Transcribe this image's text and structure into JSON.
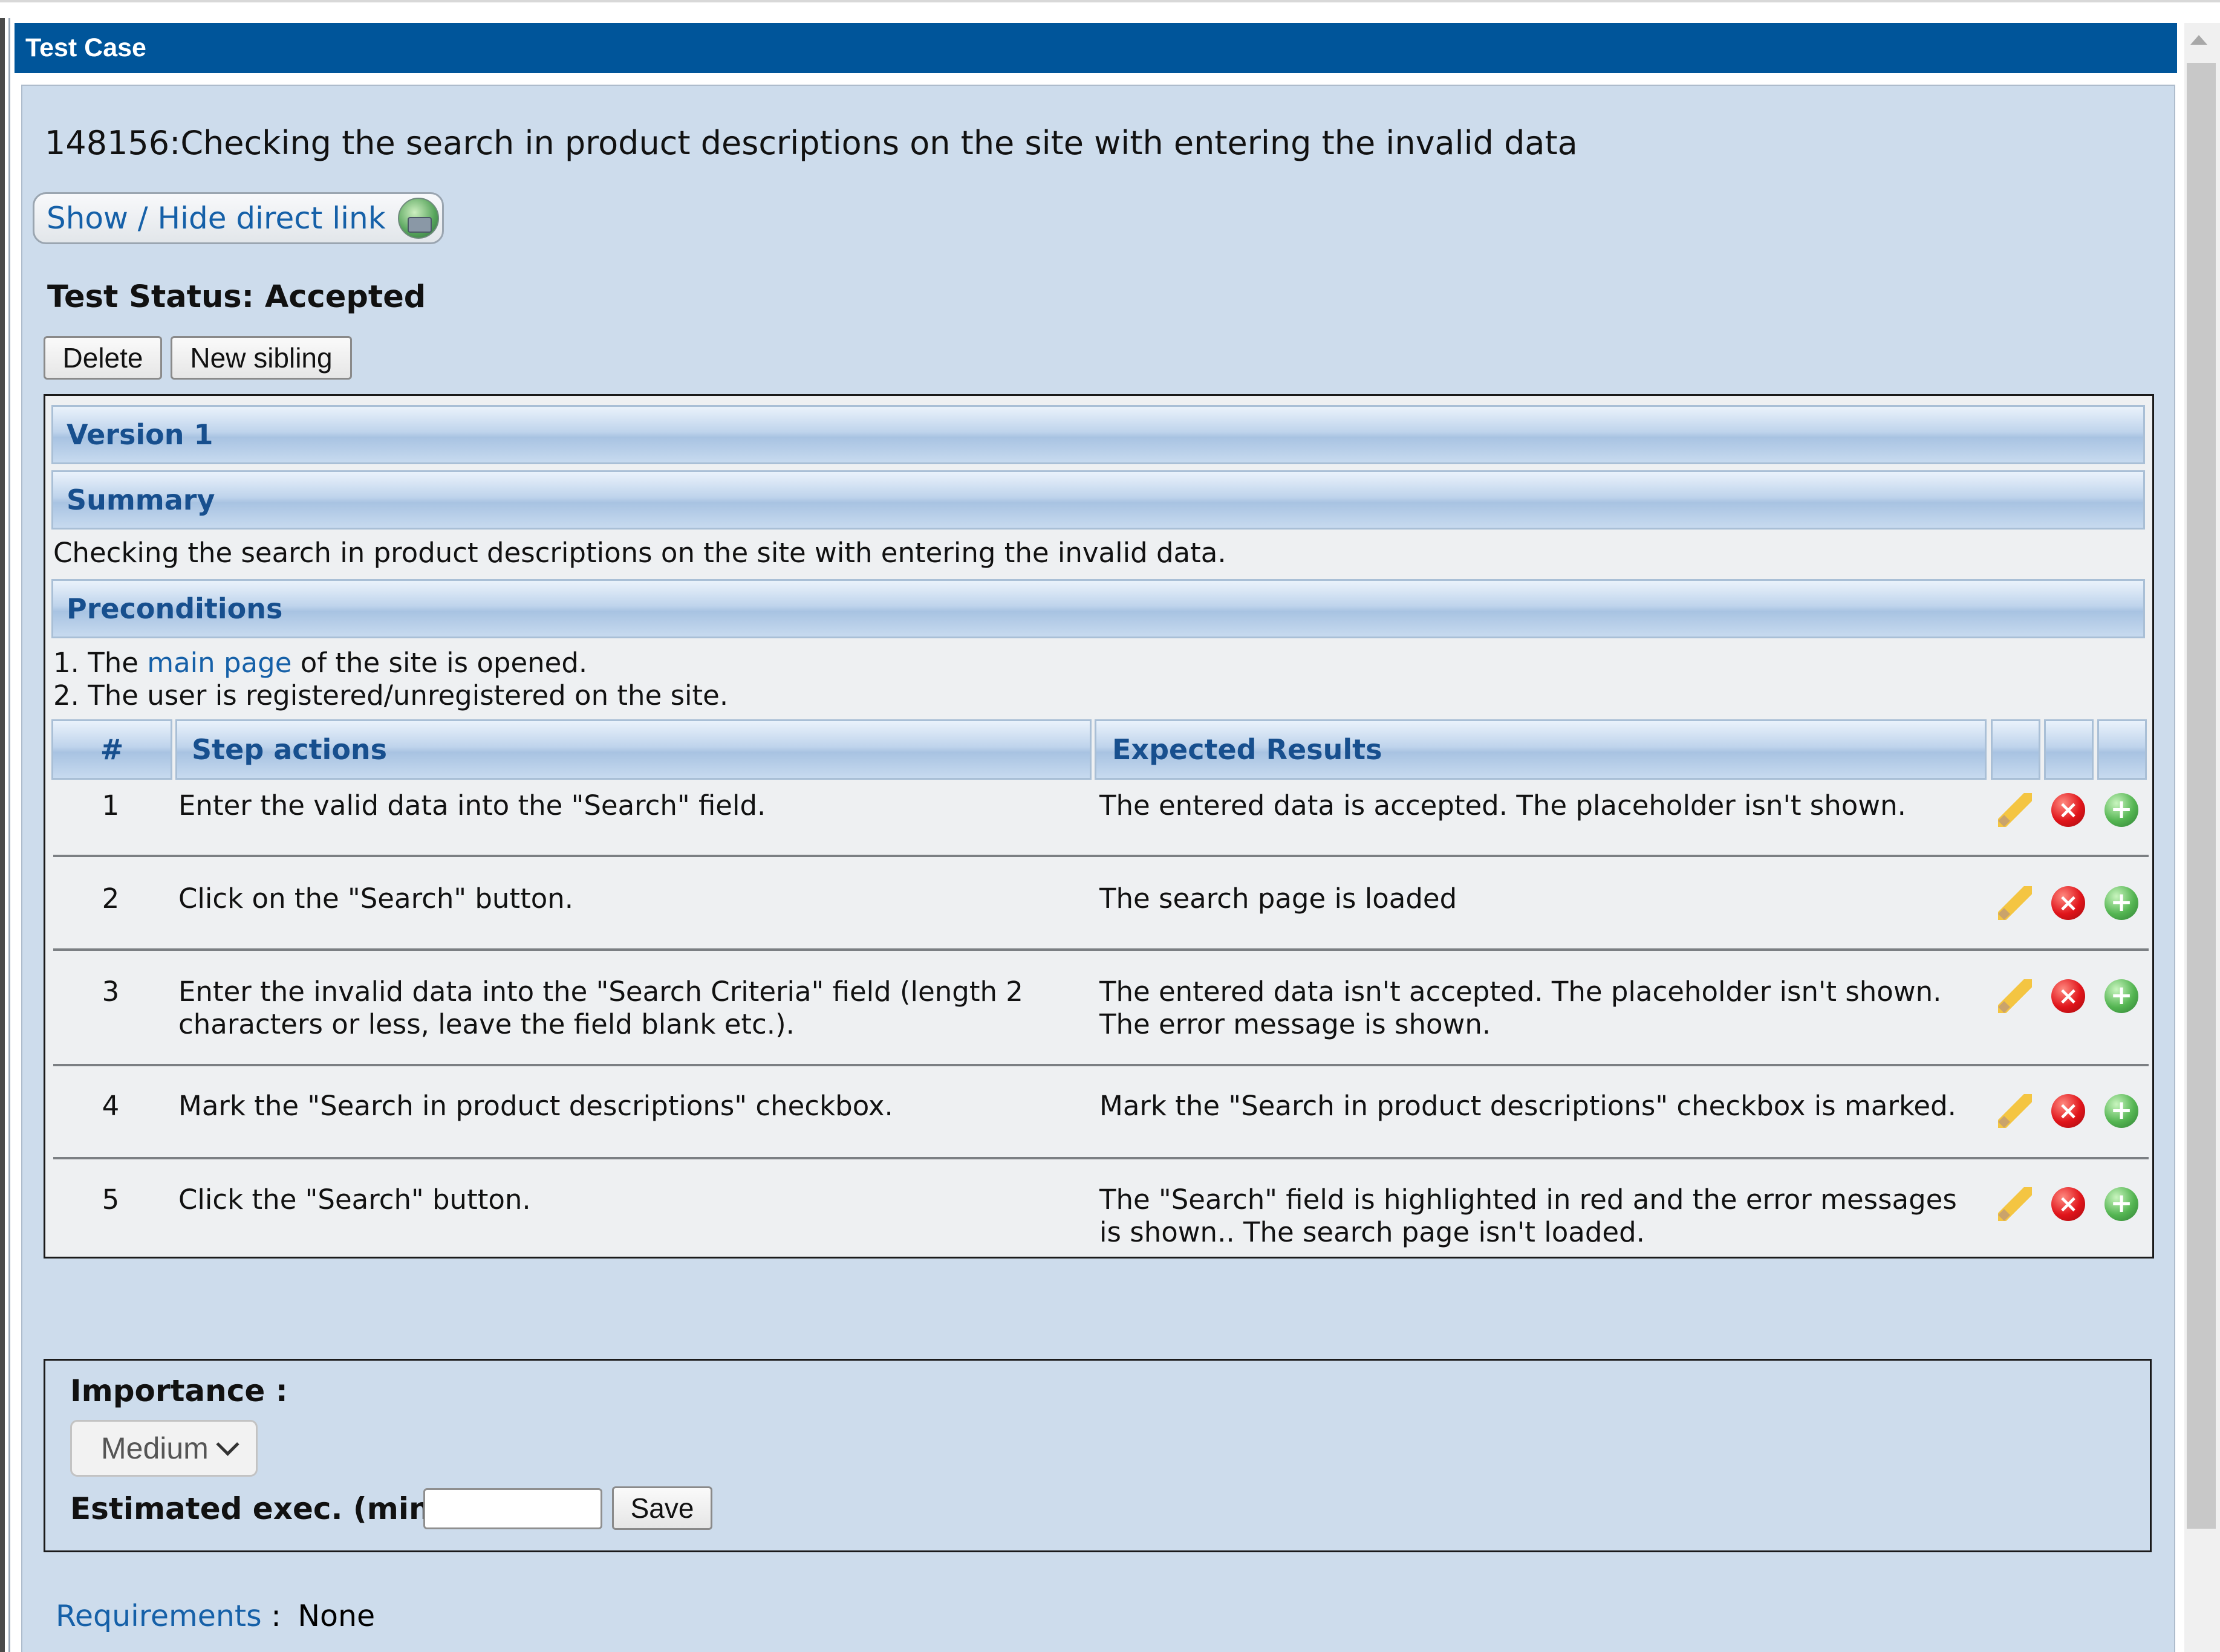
{
  "window": {
    "title": "Test Case"
  },
  "test_case": {
    "title": "148156:Checking the search in product descriptions on the site with entering the invalid data",
    "direct_link_label": "Show / Hide direct link",
    "status_label": "Test Status: Accepted",
    "delete_label": "Delete",
    "new_sibling_label": "New sibling"
  },
  "version": {
    "label": "Version 1"
  },
  "summary": {
    "heading": "Summary",
    "text": "Checking the search in product descriptions on the site with entering the invalid data."
  },
  "preconditions": {
    "heading": "Preconditions",
    "line1_prefix": "1. The ",
    "line1_link": "main page",
    "line1_suffix": " of the site is opened.",
    "line2": "2. The user is registered/unregistered on the site."
  },
  "steps_table": {
    "headers": {
      "num": "#",
      "actions": "Step actions",
      "expected": "Expected Results"
    },
    "rows": [
      {
        "num": "1",
        "action": "Enter the valid data into the \"Search\" field.",
        "expected": "The entered data is accepted. The placeholder isn't shown."
      },
      {
        "num": "2",
        "action": "Click on the \"Search\" button.",
        "expected": "The search page is loaded"
      },
      {
        "num": "3",
        "action": "Enter the invalid data into the \"Search Criteria\" field  (length 2 characters or less, leave the field blank etc.).",
        "expected": "The entered data isn't accepted. The placeholder isn't shown. The error message is shown."
      },
      {
        "num": "4",
        "action": "Mark the \"Search in product descriptions\" checkbox.",
        "expected": "Mark the \"Search in product descriptions\" checkbox is marked."
      },
      {
        "num": "5",
        "action": "Click the \"Search\" button.",
        "expected": "The \"Search\" field is highlighted in red and the error messages is shown.. The search page isn't loaded."
      }
    ],
    "row_icons": [
      "pencil-icon",
      "delete-icon",
      "add-icon"
    ]
  },
  "details": {
    "importance_label": "Importance :",
    "importance_value": "Medium",
    "estimated_label": "Estimated exec. (min) :",
    "estimated_value": "",
    "save_label": "Save"
  },
  "requirements": {
    "label": "Requirements",
    "separator": " : ",
    "value": "None"
  },
  "colors": {
    "title_bar": "#00559a",
    "panel_bg": "#cddcec",
    "link": "#1560a8",
    "header_text": "#174f8e"
  }
}
